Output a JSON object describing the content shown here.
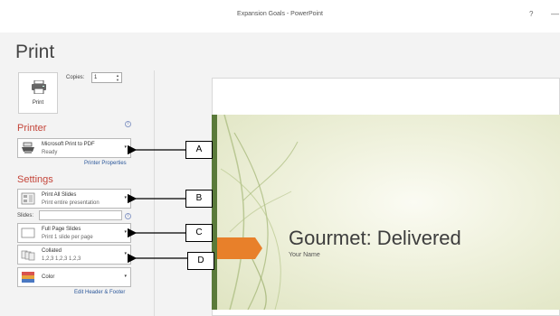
{
  "window": {
    "title": "Expansion Goals - PowerPoint",
    "help_icon": "?",
    "minimize_icon": "—"
  },
  "page": {
    "heading": "Print"
  },
  "print_button": {
    "label": "Print",
    "icon": "printer-icon"
  },
  "copies": {
    "label": "Copies:",
    "value": "1",
    "spin_up": "▲",
    "spin_down": "▼"
  },
  "printer": {
    "heading": "Printer",
    "info": "i",
    "name": "Microsoft Print to PDF",
    "status": "Ready",
    "icon": "printer-device-icon",
    "properties_link": "Printer Properties"
  },
  "settings": {
    "heading": "Settings",
    "range": {
      "title": "Print All Slides",
      "subtitle": "Print entire presentation",
      "icon": "slides-range-icon"
    },
    "slides": {
      "label": "Slides:",
      "value": "",
      "info": "i"
    },
    "layout": {
      "title": "Full Page Slides",
      "subtitle": "Print 1 slide per page",
      "icon": "full-page-icon"
    },
    "collation": {
      "title": "Collated",
      "subtitle": "1,2,3    1,2,3    1,2,3",
      "icon": "collated-icon"
    },
    "color": {
      "title": "Color",
      "icon": "color-swatch-icon"
    },
    "edit_header_footer_link": "Edit Header & Footer"
  },
  "caret": "▾",
  "preview": {
    "slide_title": "Gourmet: Delivered",
    "slide_subtitle": "Your Name",
    "accent_color": "#e8802a",
    "bar_color": "#5a7a3a"
  },
  "callouts": [
    "A",
    "B",
    "C",
    "D"
  ]
}
